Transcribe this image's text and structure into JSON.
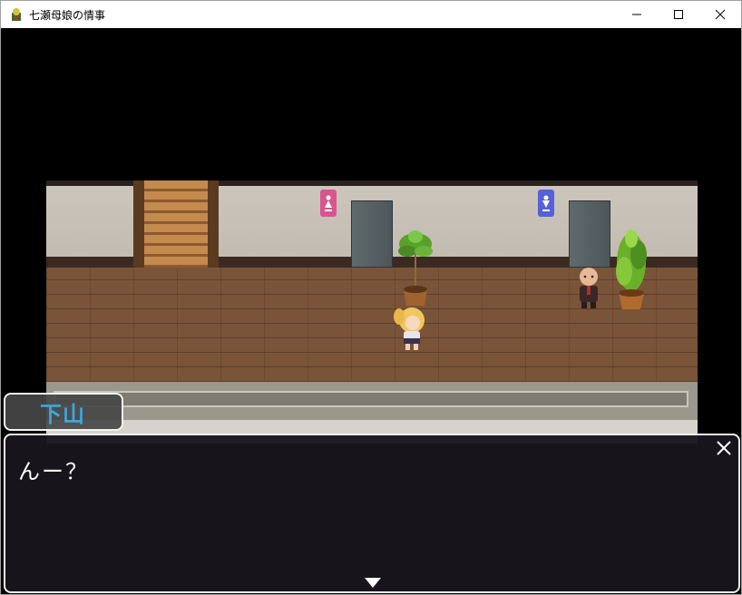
{
  "window": {
    "title": "七瀬母娘の情事",
    "controls": [
      "minimize",
      "maximize",
      "close"
    ]
  },
  "dialogue": {
    "speaker": "下山",
    "text": "んー？"
  },
  "icons": {
    "app": "app-icon",
    "minimize": "minimize-icon",
    "maximize": "maximize-icon",
    "close": "close-icon",
    "message_close": "message-close-icon",
    "advance": "advance-arrow-icon"
  },
  "colors": {
    "speaker_name": "#3aa7e0",
    "window_border": "#f2f2f2",
    "female_sign": "#d9558f",
    "male_sign": "#5560d9"
  }
}
